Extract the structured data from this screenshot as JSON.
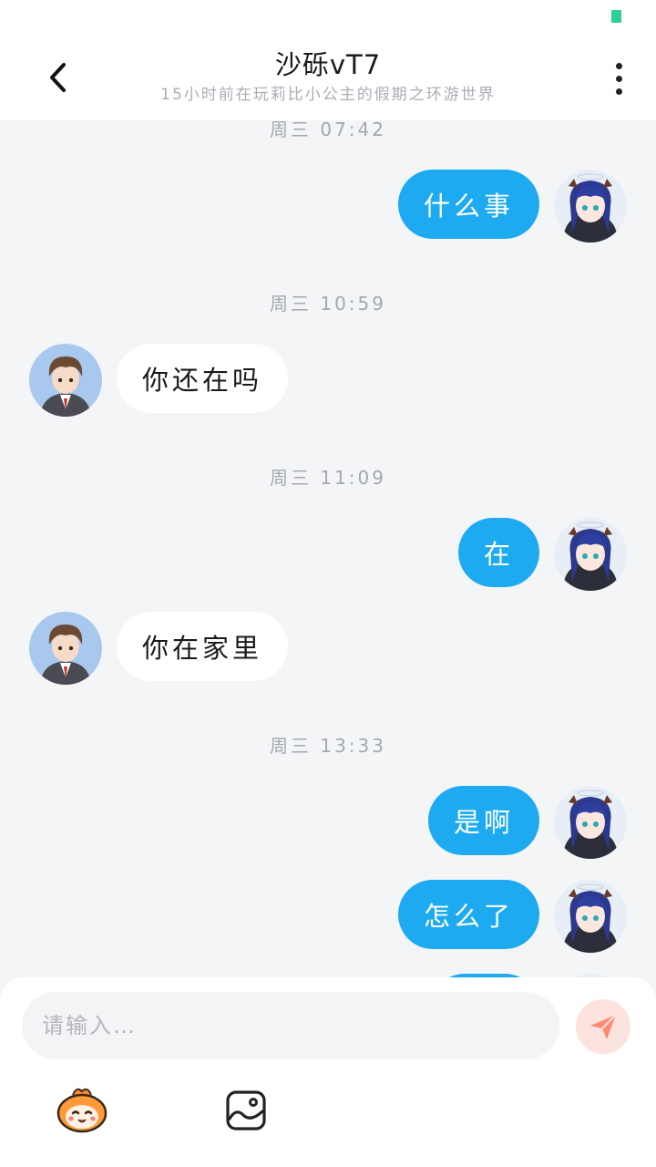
{
  "header": {
    "title": "沙砾vT7",
    "subtitle": "15小时前在玩莉比小公主的假期之环游世界"
  },
  "messages": {
    "ts1": "周三 07:42",
    "m1": "什么事",
    "ts2": "周三 10:59",
    "m2": "你还在吗",
    "ts3": "周三 11:09",
    "m3": "在",
    "m4": "你在家里",
    "ts4": "周三 13:33",
    "m5": "是啊",
    "m6": "怎么了"
  },
  "composer": {
    "placeholder": "请输入…"
  },
  "colors": {
    "accent": "#1eaaf1",
    "send": "#fd8a72",
    "status": "#2ecf9a"
  },
  "icons": [
    "back-arrow-icon",
    "more-vertical-icon",
    "send-icon",
    "mascot-emoji-icon",
    "image-icon"
  ]
}
